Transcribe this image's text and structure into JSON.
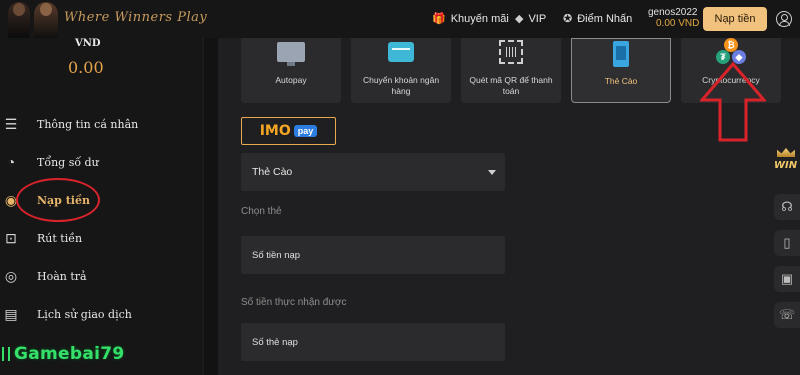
{
  "header": {
    "brand": "Where Winners Play",
    "nav": [
      {
        "icon": "gift-icon",
        "glyph": "🎁",
        "label": "Khuyến mãi"
      },
      {
        "icon": "diamond-icon",
        "glyph": "◆",
        "label": "VIP"
      },
      {
        "icon": "badge-icon",
        "glyph": "✪",
        "label": "Điểm Nhấn"
      }
    ],
    "username": "genos2022",
    "balance": "0.00 VND",
    "deposit_label": "Nạp tiền"
  },
  "sidebar": {
    "currency": "VND",
    "balance": "0.00",
    "items": [
      {
        "label": "Thông tin cá nhân",
        "icon": "user-list-icon",
        "glyph": "☰"
      },
      {
        "label": "Tổng số dư",
        "icon": "pie-chart-icon",
        "glyph": "◔"
      },
      {
        "label": "Nạp tiền",
        "icon": "deposit-icon",
        "glyph": "◉"
      },
      {
        "label": "Rút tiền",
        "icon": "withdraw-icon",
        "glyph": "⊡"
      },
      {
        "label": "Hoàn trả",
        "icon": "refund-icon",
        "glyph": "◎"
      },
      {
        "label": "Lịch sử giao dịch",
        "icon": "history-icon",
        "glyph": "▤"
      }
    ],
    "active_index": 2
  },
  "watermark": "Gamebai79",
  "payment_methods": [
    {
      "label": "Autopay",
      "icon": "monitor-icon"
    },
    {
      "label": "Chuyển khoản ngân hàng",
      "icon": "bank-card-icon"
    },
    {
      "label": "Quét mã QR để thanh toán",
      "icon": "qr-code-icon"
    },
    {
      "label": "Thẻ Cào",
      "icon": "phone-card-icon",
      "selected": true
    },
    {
      "label": "Cryptocurrency",
      "icon": "crypto-icon"
    }
  ],
  "provider": {
    "name": "IMO",
    "tag": "pay"
  },
  "form": {
    "card_type_value": "Thẻ Cào",
    "card_select_label": "Chọn thẻ",
    "amount_placeholder": "Số tiền nạp",
    "received_label": "Số tiền thực nhận được",
    "card_number_placeholder": "Số thẻ nạp"
  },
  "floating": {
    "win_label": "WIN"
  },
  "colors": {
    "accent": "#f0c27d",
    "balance": "#e3a24a",
    "annotation": "#d8232a",
    "watermark": "#35e06a"
  }
}
